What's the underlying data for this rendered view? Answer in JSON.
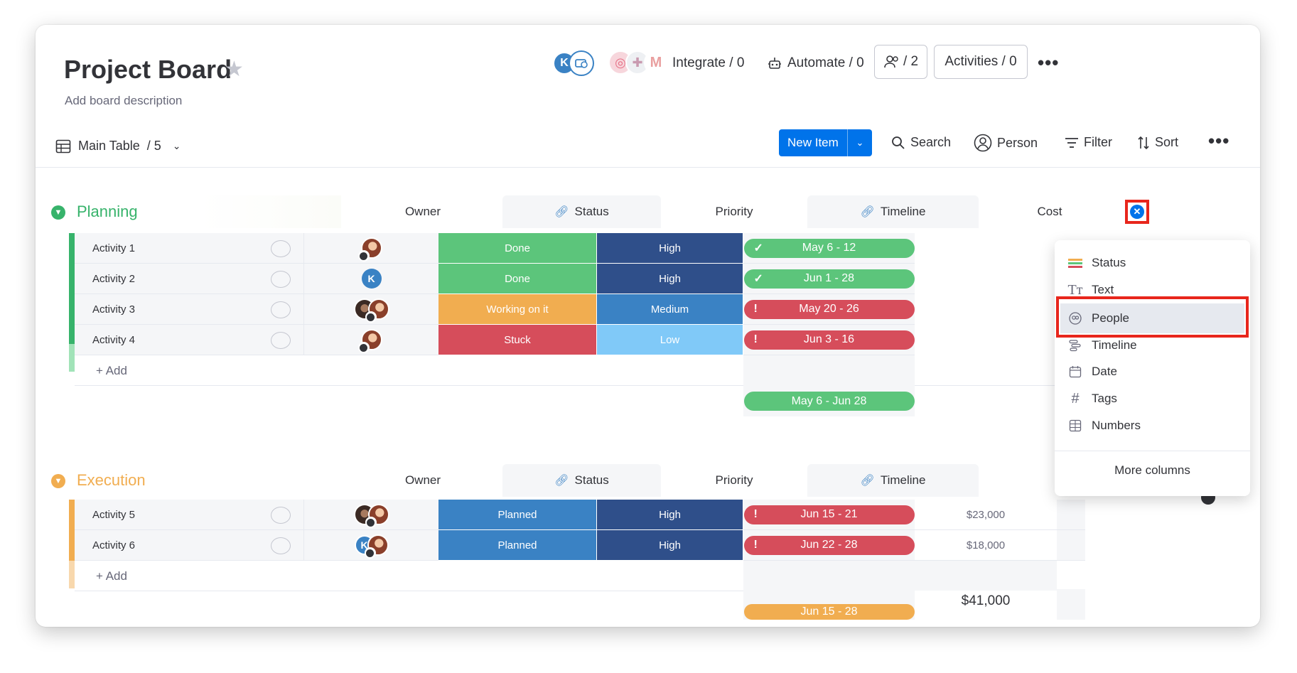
{
  "board": {
    "title": "Project Board",
    "description": "Add board description"
  },
  "header": {
    "avatar_initial": "K",
    "integrate": "Integrate / 0",
    "automate": "Automate / 0",
    "members": "/ 2",
    "activities": "Activities / 0",
    "more": "•••"
  },
  "toolbar": {
    "view_name": "Main Table",
    "view_count": "/ 5",
    "new_item": "New Item",
    "search": "Search",
    "person": "Person",
    "filter": "Filter",
    "sort": "Sort",
    "more": "•••"
  },
  "columns": {
    "owner": "Owner",
    "status": "Status",
    "priority": "Priority",
    "timeline": "Timeline",
    "cost": "Cost"
  },
  "groups": [
    {
      "title": "Planning",
      "color": "#37b36b",
      "items": [
        {
          "name": "Activity 1",
          "status": "Done",
          "status_color": "#5cc57b",
          "priority": "High",
          "priority_color": "#2f4f8a",
          "timeline": "May 6 - 12",
          "timeline_color": "#5cc57b",
          "timeline_mark": "✓"
        },
        {
          "name": "Activity 2",
          "status": "Done",
          "status_color": "#5cc57b",
          "priority": "High",
          "priority_color": "#2f4f8a",
          "timeline": "Jun 1 - 28",
          "timeline_color": "#5cc57b",
          "timeline_mark": "✓"
        },
        {
          "name": "Activity 3",
          "status": "Working on it",
          "status_color": "#f1ad50",
          "priority": "Medium",
          "priority_color": "#3a82c4",
          "timeline": "May 20 - 26",
          "timeline_color": "#d64d5b",
          "timeline_mark": "!"
        },
        {
          "name": "Activity 4",
          "status": "Stuck",
          "status_color": "#d64d5b",
          "priority": "Low",
          "priority_color": "#80c9f8",
          "timeline": "Jun 3 - 16",
          "timeline_color": "#d64d5b",
          "timeline_mark": "!"
        }
      ],
      "add_label": "+ Add",
      "summary_timeline": "May 6 - Jun 28"
    },
    {
      "title": "Execution",
      "color": "#f1ad50",
      "items": [
        {
          "name": "Activity 5",
          "status": "Planned",
          "status_color": "#3a82c4",
          "priority": "High",
          "priority_color": "#2f4f8a",
          "timeline": "Jun 15 - 21",
          "timeline_color": "#d64d5b",
          "timeline_mark": "!",
          "cost": "$23,000"
        },
        {
          "name": "Activity 6",
          "status": "Planned",
          "status_color": "#3a82c4",
          "priority": "High",
          "priority_color": "#2f4f8a",
          "timeline": "Jun 22 - 28",
          "timeline_color": "#d64d5b",
          "timeline_mark": "!",
          "cost": "$18,000",
          "owner_initial": "K"
        }
      ],
      "add_label": "+ Add",
      "summary_timeline": "Jun 15 - 28",
      "summary_cost": "$41,000"
    }
  ],
  "column_menu": {
    "items": [
      "Status",
      "Text",
      "People",
      "Timeline",
      "Date",
      "Tags",
      "Numbers"
    ],
    "highlighted": "People",
    "more": "More columns"
  },
  "colors": {
    "accent": "#0073ea",
    "highlight_box": "#e8261c"
  }
}
